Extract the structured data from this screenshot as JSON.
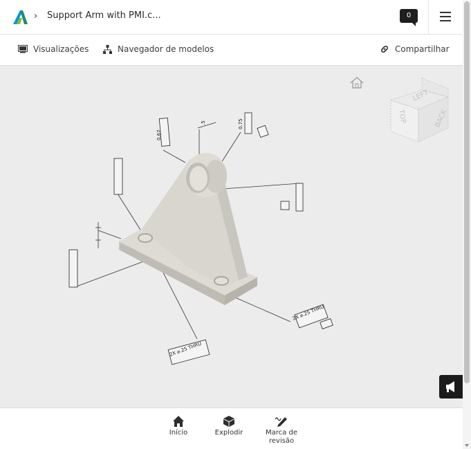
{
  "header": {
    "file_title": "Support Arm with PMI.c...",
    "comment_count": "0"
  },
  "toolbar": {
    "views_label": "Visualizações",
    "model_browser_label": "Navegador de modelos",
    "share_label": "Compartilhar"
  },
  "viewcube": {
    "faces": [
      "LEFT",
      "BACK",
      "TOP"
    ]
  },
  "annotations": {
    "dim_top_center": ".5",
    "dim_left_top": "0.67",
    "dim_right_top": "0.75",
    "dim_bottom": "2X ⌀.25 THRU",
    "dim_right_bottom": "2X ⌀.25 THRU"
  },
  "bottombar": {
    "home_label": "Início",
    "explode_label": "Explodir",
    "markup_label": "Marca de revisão"
  },
  "colors": {
    "accent": "#1e1e1e",
    "viewport_bg": "#ececec",
    "part": "#d6d4cc"
  }
}
